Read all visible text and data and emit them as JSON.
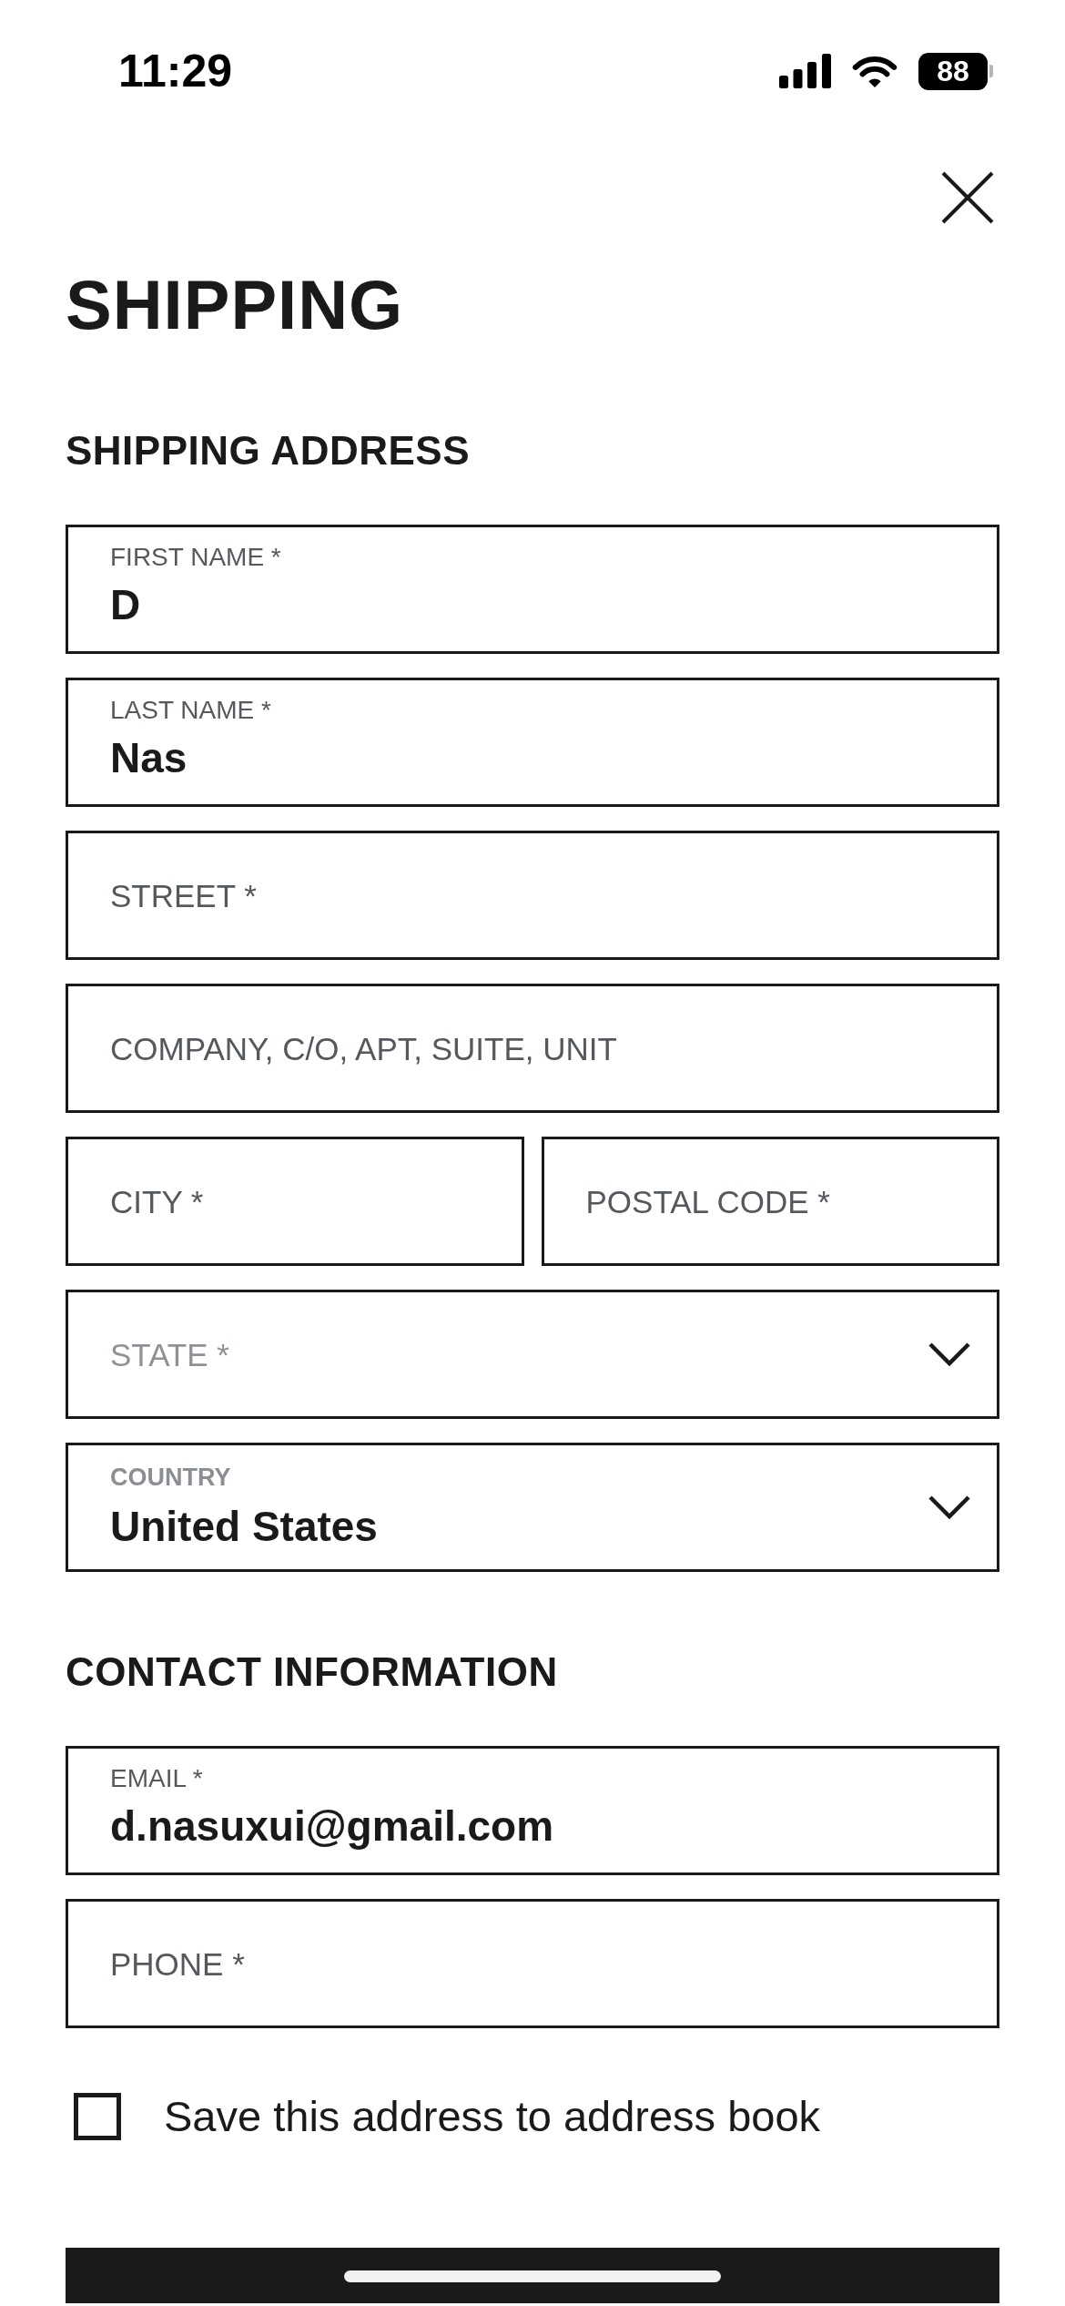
{
  "status_bar": {
    "time": "11:29",
    "battery": "88"
  },
  "title": "SHIPPING",
  "sections": [
    {
      "heading": "SHIPPING ADDRESS",
      "rows": [
        [
          {
            "kind": "text",
            "label": "FIRST NAME *",
            "value": "D"
          }
        ],
        [
          {
            "kind": "text",
            "label": "LAST NAME *",
            "value": "Nas"
          }
        ],
        [
          {
            "kind": "text",
            "placeholder": "STREET *"
          }
        ],
        [
          {
            "kind": "text",
            "placeholder": "COMPANY, C/O, APT, SUITE, UNIT"
          }
        ],
        [
          {
            "kind": "text",
            "placeholder": "CITY *"
          },
          {
            "kind": "text",
            "placeholder": "POSTAL CODE *"
          }
        ],
        [
          {
            "kind": "select",
            "placeholder": "STATE *"
          }
        ],
        [
          {
            "kind": "select",
            "label": "COUNTRY",
            "value": "United States"
          }
        ]
      ]
    },
    {
      "heading": "CONTACT INFORMATION",
      "rows": [
        [
          {
            "kind": "text",
            "label": "EMAIL *",
            "value": "d.nasuxui@gmail.com"
          }
        ],
        [
          {
            "kind": "text",
            "placeholder": "PHONE *"
          }
        ]
      ]
    }
  ],
  "save_address": {
    "label": "Save this address to address book",
    "checked": false
  }
}
